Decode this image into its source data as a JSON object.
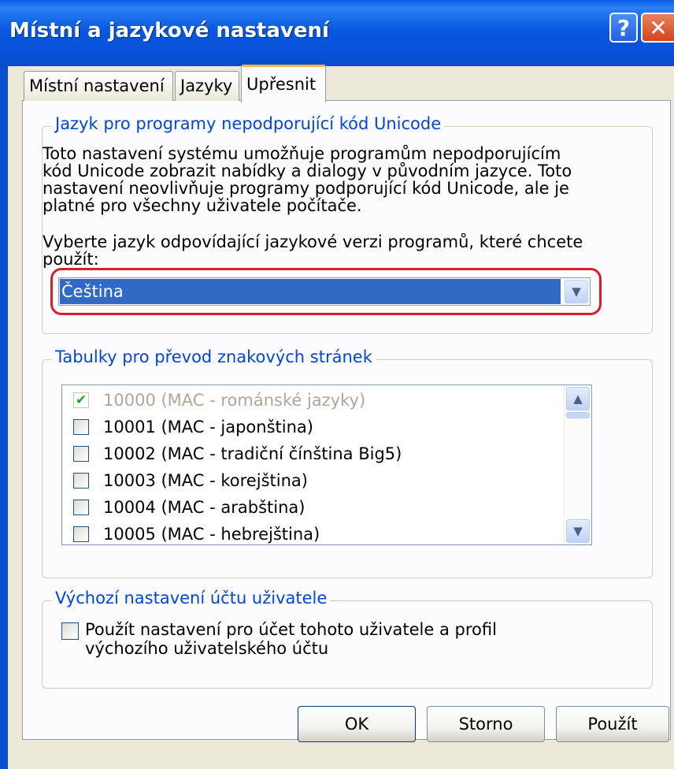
{
  "window": {
    "title": "Místní a jazykové nastavení",
    "help_symbol": "?",
    "close_symbol": "✕"
  },
  "tabs": [
    {
      "label": "Místní nastavení",
      "active": false
    },
    {
      "label": "Jazyky",
      "active": false
    },
    {
      "label": "Upřesnit",
      "active": true
    }
  ],
  "unicode_group": {
    "legend": "Jazyk pro programy nepodporující kód Unicode",
    "description": "Toto nastavení systému umožňuje programům nepodporujícím kód Unicode zobrazit nabídky a dialogy v původním jazyce. Toto nastavení neovlivňuje programy podporující kód Unicode, ale je platné pro všechny uživatele počítače.",
    "prompt": "Vyberte jazyk odpovídající jazykové verzi programů, které chcete použít:",
    "selected_language": "Čeština"
  },
  "codepage_group": {
    "legend": "Tabulky pro převod znakových stránek",
    "items": [
      {
        "label": "10000 (MAC - románské jazyky)",
        "checked": true,
        "disabled": true
      },
      {
        "label": "10001 (MAC - japonština)",
        "checked": false,
        "disabled": false
      },
      {
        "label": "10002 (MAC - tradiční čínština Big5)",
        "checked": false,
        "disabled": false
      },
      {
        "label": "10003 (MAC - korejština)",
        "checked": false,
        "disabled": false
      },
      {
        "label": "10004 (MAC - arabština)",
        "checked": false,
        "disabled": false
      },
      {
        "label": "10005 (MAC - hebrejština)",
        "checked": false,
        "disabled": false
      }
    ]
  },
  "user_group": {
    "legend": "Výchozí nastavení účtu uživatele",
    "checkbox_label": "Použít nastavení pro účet tohoto uživatele a profil výchozího uživatelského účtu",
    "checked": false
  },
  "buttons": {
    "ok": "OK",
    "cancel": "Storno",
    "apply": "Použít"
  },
  "colors": {
    "title_bar": "#0a58df",
    "selection": "#316ac5",
    "highlight_annotation": "#d4202c",
    "group_legend": "#0046d5"
  }
}
